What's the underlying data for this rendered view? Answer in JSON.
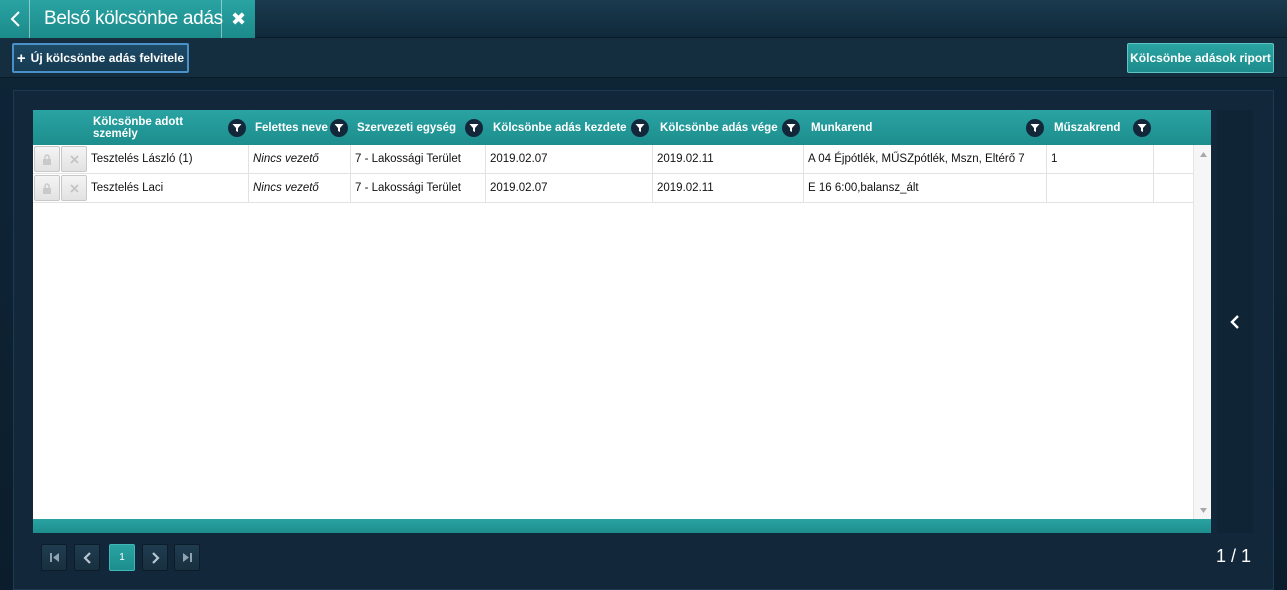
{
  "tab": {
    "title": "Belső kölcsönbe adás",
    "back_icon": "chevron-left-icon",
    "close_icon": "close-icon"
  },
  "toolbar": {
    "new_label": "Új kölcsönbe adás felvitele",
    "report_label": "Kölcsönbe adások riport"
  },
  "grid": {
    "columns": [
      "Kölcsönbe adott személy",
      "Felettes neve",
      "Szervezeti egység",
      "Kölcsönbe adás kezdete",
      "Kölcsönbe adás vége",
      "Munkarend",
      "Műszakrend"
    ],
    "rows": [
      {
        "person": "Tesztelés László (1)",
        "supervisor": "Nincs vezető",
        "unit": "7 - Lakossági Terület",
        "start": "2019.02.07",
        "end": "2019.02.11",
        "schedule": "A 04 Éjpótlék, MŰSZpótlék, Mszn, Eltérő 7",
        "shift": "1"
      },
      {
        "person": "Tesztelés Laci",
        "supervisor": "Nincs vezető",
        "unit": "7 - Lakossági Terület",
        "start": "2019.02.07",
        "end": "2019.02.11",
        "schedule": "E 16 6:00,balansz_ált",
        "shift": ""
      }
    ]
  },
  "pager": {
    "current_page": "1",
    "page_info": "1 / 1"
  },
  "colors": {
    "accent": "#2aa3a3",
    "background": "#0f2638",
    "header_dark": "#12283a"
  }
}
